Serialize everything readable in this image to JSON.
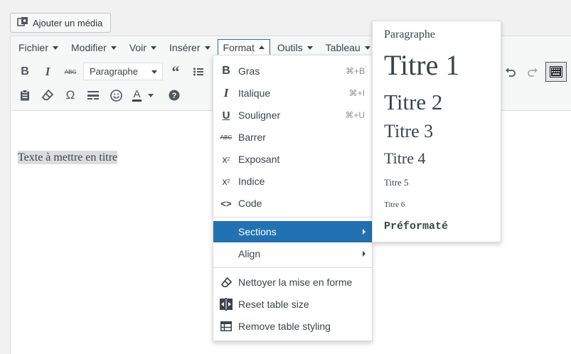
{
  "media_button": {
    "label": "Ajouter un média",
    "icon": "media-icon"
  },
  "menubar": {
    "items": [
      {
        "label": "Fichier",
        "active": false
      },
      {
        "label": "Modifier",
        "active": false
      },
      {
        "label": "Voir",
        "active": false
      },
      {
        "label": "Insérer",
        "active": false
      },
      {
        "label": "Format",
        "active": true
      },
      {
        "label": "Outils",
        "active": false
      },
      {
        "label": "Tableau",
        "active": false
      }
    ]
  },
  "toolbar": {
    "format_select": "Paragraphe",
    "row1_icons": [
      "bold-icon",
      "italic-icon",
      "strikethrough-icon",
      "blockquote-icon",
      "bullet-list-icon",
      "undo-icon",
      "redo-icon",
      "kitchen-sink-icon"
    ],
    "row2_icons": [
      "paste-text-icon",
      "clear-formatting-icon",
      "omega-icon",
      "horizontal-rule-icon",
      "emoji-icon",
      "text-color-icon",
      "help-icon"
    ]
  },
  "content": {
    "text": "Texte à mettre en titre"
  },
  "format_menu": {
    "items": [
      {
        "label": "Gras",
        "shortcut": "⌘+B",
        "icon": "bold-icon"
      },
      {
        "label": "Italique",
        "shortcut": "⌘+I",
        "icon": "italic-icon"
      },
      {
        "label": "Souligner",
        "shortcut": "⌘+U",
        "icon": "underline-icon"
      },
      {
        "label": "Barrer",
        "shortcut": "",
        "icon": "strikethrough-icon"
      },
      {
        "label": "Exposant",
        "shortcut": "",
        "icon": "superscript-icon"
      },
      {
        "label": "Indice",
        "shortcut": "",
        "icon": "subscript-icon"
      },
      {
        "label": "Code",
        "shortcut": "",
        "icon": "code-icon"
      }
    ],
    "sections": "Sections",
    "align": "Align",
    "clear_formatting": "Nettoyer la mise en forme",
    "reset_table_size": "Reset table size",
    "remove_table_styling": "Remove table styling"
  },
  "sections_submenu": {
    "items": [
      "Paragraphe",
      "Titre 1",
      "Titre 2",
      "Titre 3",
      "Titre 4",
      "Titre 5",
      "Titre 6",
      "Préformaté"
    ]
  },
  "colors": {
    "accent": "#2271b1",
    "text": "#3c434a",
    "border": "#dcdcde"
  }
}
